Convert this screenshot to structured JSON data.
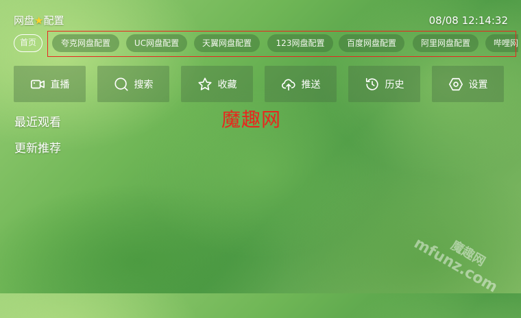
{
  "header": {
    "title_left": "网盘",
    "title_star": "★",
    "title_right": "配置",
    "clock": "08/08 12:14:32"
  },
  "tabs": [
    {
      "label": "首页"
    },
    {
      "label": "夸克网盘配置"
    },
    {
      "label": "UC网盘配置"
    },
    {
      "label": "天翼网盘配置"
    },
    {
      "label": "123网盘配置"
    },
    {
      "label": "百度网盘配置"
    },
    {
      "label": "阿里网盘配置"
    },
    {
      "label": "哔哩网盘配置"
    }
  ],
  "buttons": [
    {
      "label": "直播",
      "icon": "video-camera-icon"
    },
    {
      "label": "搜索",
      "icon": "search-icon"
    },
    {
      "label": "收藏",
      "icon": "star-icon"
    },
    {
      "label": "推送",
      "icon": "cloud-upload-icon"
    },
    {
      "label": "历史",
      "icon": "history-icon"
    },
    {
      "label": "设置",
      "icon": "settings-hex-icon"
    }
  ],
  "sections": {
    "recent": "最近观看",
    "updates": "更新推荐"
  },
  "overlay_text": "魔趣网",
  "watermark": {
    "line1": "魔趣网",
    "line2": "mfunz.com"
  },
  "colors": {
    "annotation_red": "#e8261e",
    "star_yellow": "#ffd22c"
  }
}
